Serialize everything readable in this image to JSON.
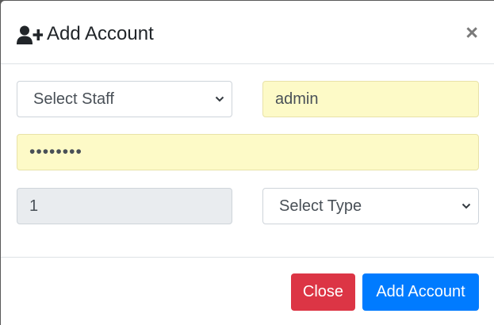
{
  "header": {
    "icon": "user-plus-icon",
    "title": "Add Account",
    "close_glyph": "×"
  },
  "form": {
    "staff_select": {
      "value": "Select Staff",
      "icon": "chevron-down-icon"
    },
    "username": {
      "value": "admin"
    },
    "password": {
      "value": "••••••••"
    },
    "number": {
      "value": "1"
    },
    "type_select": {
      "value": "Select Type",
      "icon": "chevron-down-icon"
    }
  },
  "footer": {
    "close_label": "Close",
    "add_label": "Add Account"
  },
  "colors": {
    "danger": "#dc3545",
    "primary": "#007bff",
    "autofill": "#fdfac7",
    "readonly": "#e9ecef"
  }
}
